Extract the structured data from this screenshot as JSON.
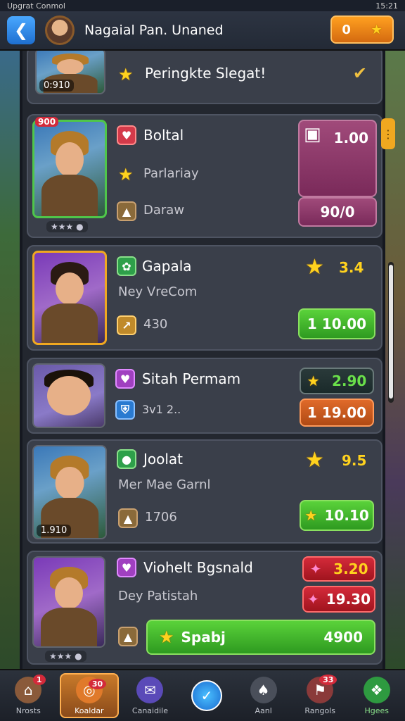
{
  "status_bar": {
    "left": "Upgrat Conmol",
    "right": "15:21"
  },
  "header": {
    "title": "Nagaial Pan. Unaned",
    "coins": "0"
  },
  "banner": {
    "text": "Peringkte Slegat!",
    "level": "0:910"
  },
  "cards": [
    {
      "name": "Boltal",
      "line2": "Parlariay",
      "line3": "Daraw",
      "badge": "900",
      "price_top": "1.00",
      "price_bottom": "90/0"
    },
    {
      "name": "Gapala",
      "line2": "Ney VreCom",
      "line3": "430",
      "rating": "3.4",
      "button": "1 10.00"
    },
    {
      "name": "Sitah Permam",
      "line2": "3v1 2..",
      "price_top": "2.90",
      "button": "1 19.00"
    },
    {
      "name": "Joolat",
      "line2": "Mer Mae Garnl",
      "line3": "1706",
      "level": "1.910",
      "rating": "9.5",
      "button": "10.10"
    },
    {
      "name": "Viohelt Bgsnald",
      "line2": "Dey Patistah",
      "price_top": "3.20",
      "price_mid": "19.30",
      "button_label": "Spabj",
      "button_value": "4900"
    }
  ],
  "nav": [
    {
      "label": "Nrosts",
      "badge": "1"
    },
    {
      "label": "Koaldar",
      "badge": "30"
    },
    {
      "label": "Canaidile",
      "badge": ""
    },
    {
      "label": "",
      "badge": ""
    },
    {
      "label": "Aanl",
      "badge": ""
    },
    {
      "label": "Rangols",
      "badge": "33"
    },
    {
      "label": "Hgees",
      "badge": ""
    }
  ]
}
